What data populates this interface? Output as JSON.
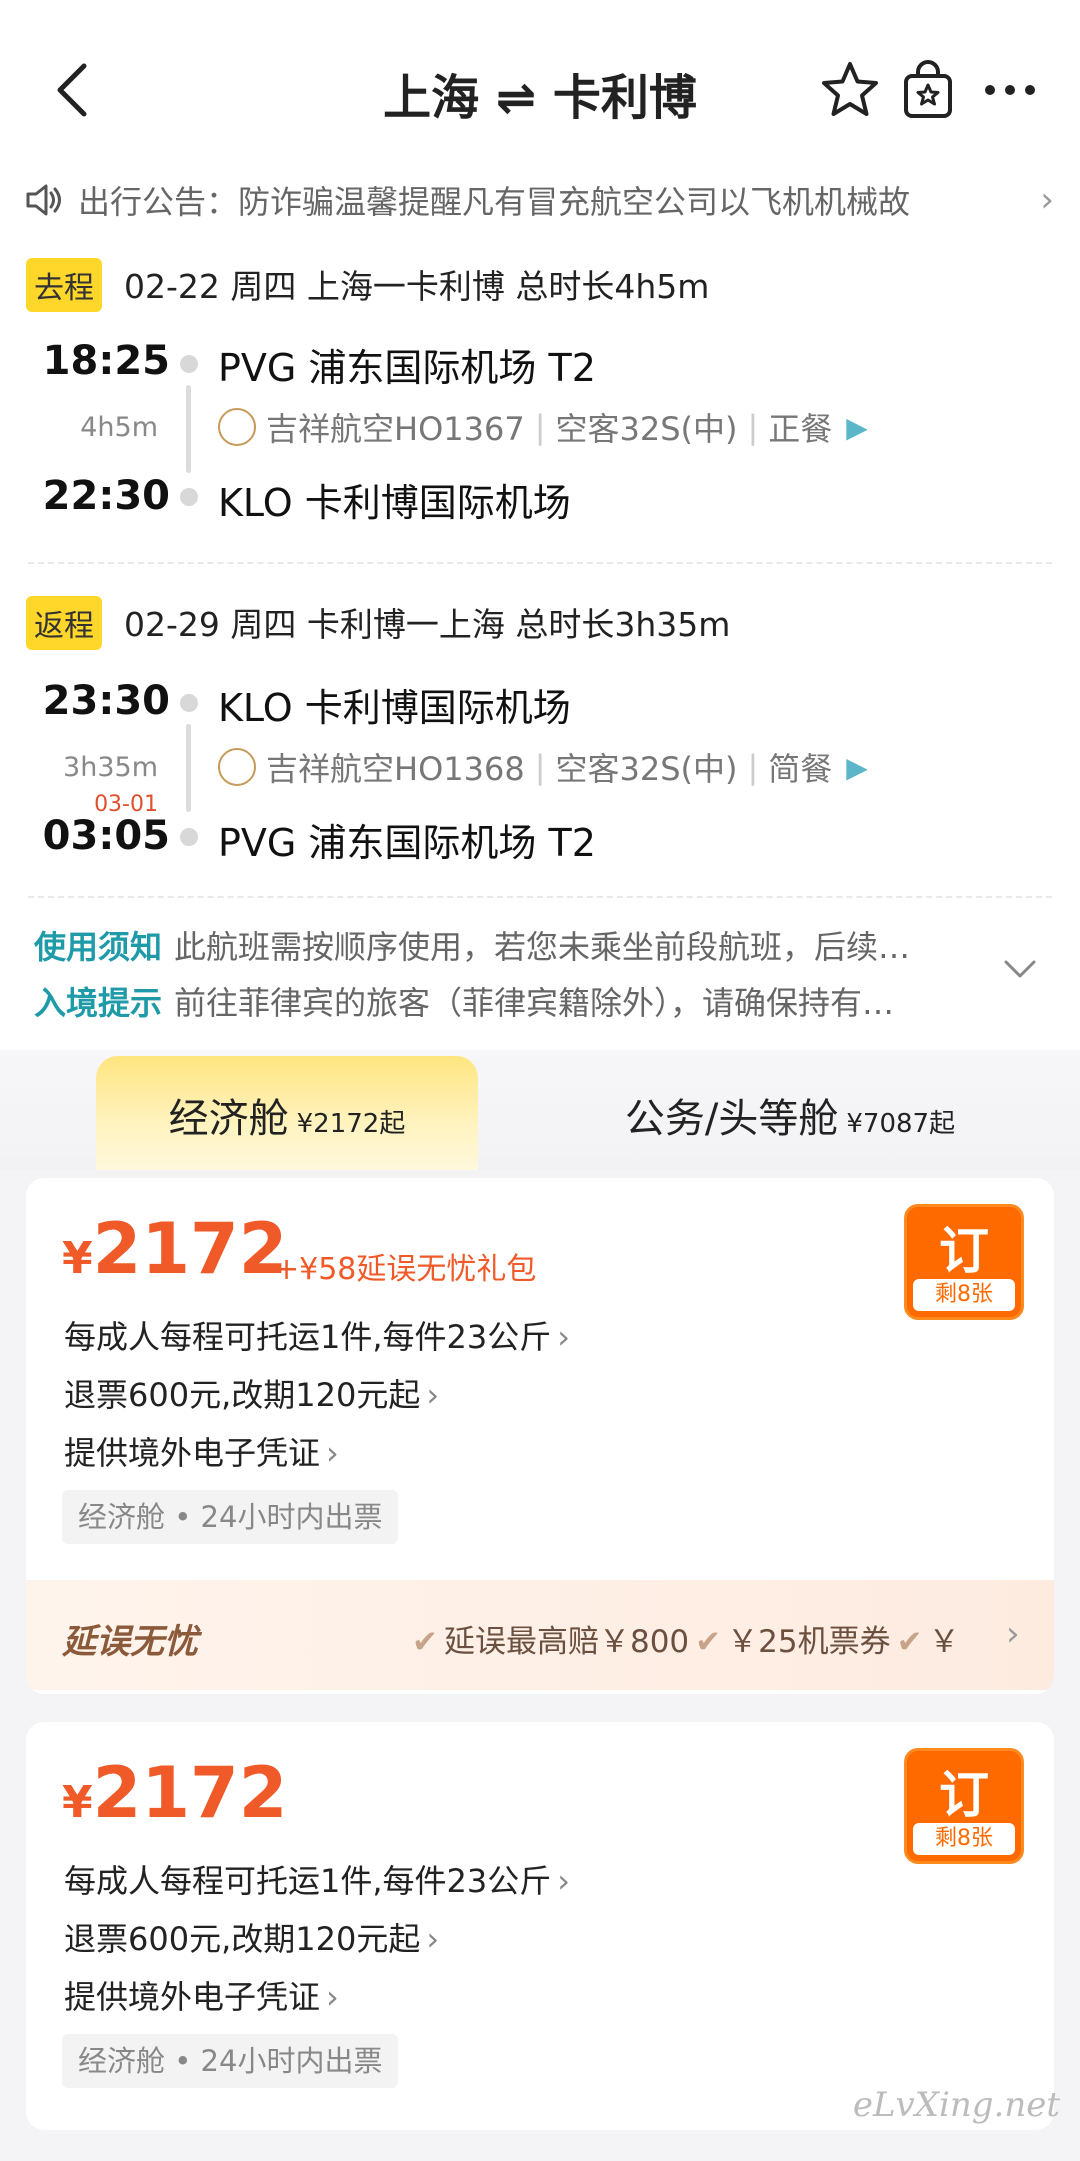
{
  "header": {
    "title": "上海 ⇌ 卡利博"
  },
  "notice": {
    "label": "出行公告：",
    "text": "防诈骗温馨提醒凡有冒充航空公司以飞机机械故"
  },
  "outbound": {
    "tag": "去程",
    "summary": "02-22  周四  上海一卡利博  总时长4h5m",
    "dep_time": "18:25",
    "dep_airport": "PVG 浦东国际机场 T2",
    "duration": "4h5m",
    "airline": "吉祥航空HO1367",
    "aircraft": "空客32S(中)",
    "meal": "正餐",
    "arr_time": "22:30",
    "arr_airport": "KLO 卡利博国际机场"
  },
  "inbound": {
    "tag": "返程",
    "summary": "02-29  周四  卡利博一上海  总时长3h35m",
    "dep_time": "23:30",
    "dep_airport": "KLO 卡利博国际机场",
    "duration": "3h35m",
    "next_day": "03-01",
    "airline": "吉祥航空HO1368",
    "aircraft": "空客32S(中)",
    "meal": "简餐",
    "arr_time": "03:05",
    "arr_airport": "PVG 浦东国际机场 T2"
  },
  "rules": [
    {
      "key": "使用须知",
      "text": "此航班需按顺序使用，若您未乘坐前段航班，后续…"
    },
    {
      "key": "入境提示",
      "text": "前往菲律宾的旅客（菲律宾籍除外），请确保持有…"
    }
  ],
  "tabs": [
    {
      "name": "经济舱",
      "price": "¥2172起",
      "active": true
    },
    {
      "name": "公务/头等舱",
      "price": "¥7087起",
      "active": false
    }
  ],
  "offers": [
    {
      "currency": "¥",
      "price": "2172",
      "package": "+¥58延误无忧礼包",
      "book": "订",
      "remaining": "剩8张",
      "baggage": "每成人每程可托运1件,每件23公斤",
      "refund": "退票600元,改期120元起",
      "voucher": "提供境外电子凭证",
      "chip": "经济舱 • 24小时内出票",
      "delay_title": "延误无忧",
      "delay_features": [
        "延误最高赔￥800",
        "￥25机票券",
        "￥"
      ]
    },
    {
      "currency": "¥",
      "price": "2172",
      "book": "订",
      "remaining": "剩8张",
      "baggage": "每成人每程可托运1件,每件23公斤",
      "refund": "退票600元,改期120元起",
      "voucher": "提供境外电子凭证",
      "chip": "经济舱 • 24小时内出票"
    }
  ],
  "watermark": "eLvXing.net"
}
